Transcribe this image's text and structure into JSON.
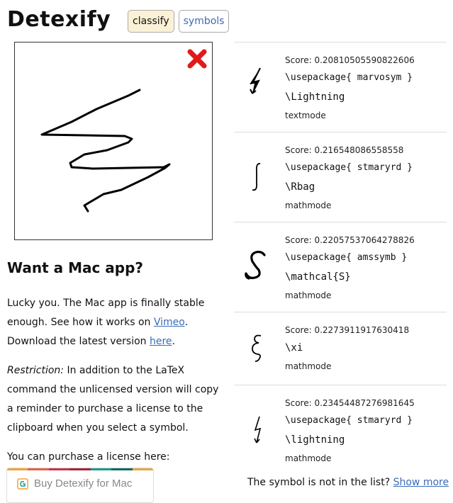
{
  "header": {
    "logo": "Detexify",
    "tabs": [
      {
        "label": "classify",
        "active": true
      },
      {
        "label": "symbols",
        "active": false
      }
    ]
  },
  "canvas": {
    "clear_icon": "close-icon",
    "clear_color": "#e01b1b"
  },
  "mac": {
    "title": "Want a Mac app?",
    "p1_text": "Lucky you. The Mac app is finally stable enough. See how it works on ",
    "p1_link": "Vimeo",
    "p1_after": ".",
    "p2_text": "Download the latest version ",
    "p2_link": "here",
    "p2_after": ".",
    "restriction_label": "Restriction:",
    "restriction_text": " In addition to the LaTeX command the unlicensed version will copy a reminder to purchase a license to the clipboard when you select a symbol.",
    "purchase_text": "You can purchase a license here:",
    "buy_label": "Buy Detexify for Mac",
    "buy_stripe_colors": [
      "#f0a13a",
      "#e0634e",
      "#c3354b",
      "#a3263a",
      "#1e9a8b",
      "#11676a",
      "#e8a63d"
    ]
  },
  "results": [
    {
      "score": "Score: 0.20810505590822606",
      "package": "\\usepackage{ marvosym }",
      "command": "\\Lightning",
      "mode": "textmode",
      "symbol_icon": "lightning-arrow-icon"
    },
    {
      "score": "Score: 0.216548086558558",
      "package": "\\usepackage{ stmaryrd }",
      "command": "\\Rbag",
      "mode": "mathmode",
      "symbol_icon": "rbag-icon"
    },
    {
      "score": "Score: 0.22057537064278826",
      "package": "\\usepackage{ amssymb }",
      "command": "\\mathcal{S}",
      "mode": "mathmode",
      "symbol_icon": "mathcal-s-icon"
    },
    {
      "score": "Score: 0.2273911917630418",
      "package": "",
      "command": "\\xi",
      "mode": "mathmode",
      "symbol_icon": "xi-icon"
    },
    {
      "score": "Score: 0.23454487276981645",
      "package": "\\usepackage{ stmaryrd }",
      "command": "\\lightning",
      "mode": "mathmode",
      "symbol_icon": "lightning-icon"
    }
  ],
  "footer": {
    "not_in_list": "The symbol is not in the list?",
    "show_more": "Show more"
  }
}
